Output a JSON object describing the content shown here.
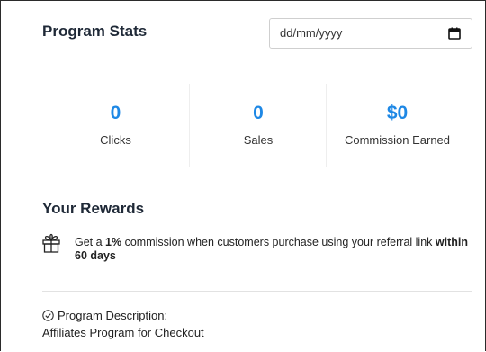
{
  "program_stats": {
    "title": "Program Stats",
    "date_input": {
      "placeholder": "dd/mm/yyyy",
      "icon": "calendar-icon"
    },
    "stats": [
      {
        "value": "0",
        "label": "Clicks"
      },
      {
        "value": "0",
        "label": "Sales"
      },
      {
        "value": "$0",
        "label": "Commission Earned"
      }
    ],
    "accent_color": "#1e88e5"
  },
  "rewards": {
    "title": "Your Rewards",
    "icon": "gift-icon",
    "text_prefix": "Get a ",
    "percent": "1%",
    "text_middle": " commission when customers purchase using your referral link ",
    "days": "within 60 days"
  },
  "description": {
    "icon": "check-circle-icon",
    "label": "Program Description:",
    "value": "Affiliates Program for Checkout"
  }
}
